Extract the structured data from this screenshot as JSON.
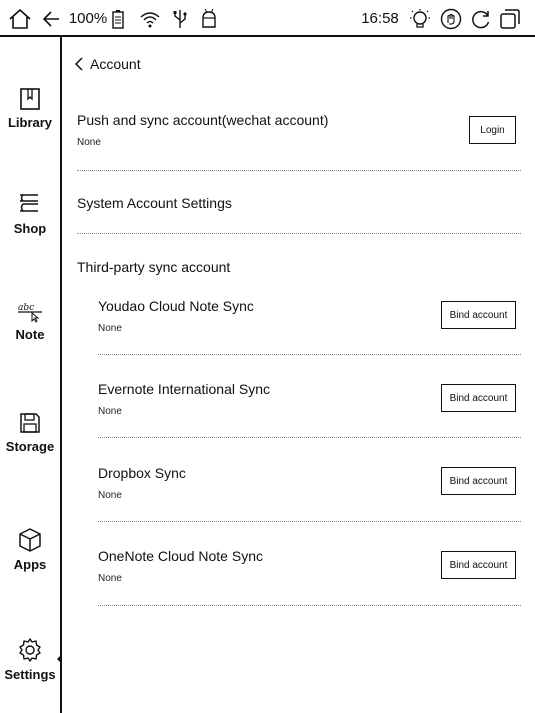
{
  "status_bar": {
    "icons": [
      "home-icon",
      "back-arrow-icon",
      "battery-icon",
      "wifi-icon",
      "usb-icon",
      "android-icon",
      "frontlight-icon",
      "touch-icon",
      "refresh-icon",
      "multitask-icon"
    ],
    "battery_percent": "100%",
    "time": "16:58"
  },
  "sidebar": {
    "items": [
      {
        "label": "Library",
        "icon": "library-icon"
      },
      {
        "label": "Shop",
        "icon": "shop-icon"
      },
      {
        "label": "Note",
        "icon": "note-icon"
      },
      {
        "label": "Storage",
        "icon": "storage-icon"
      },
      {
        "label": "Apps",
        "icon": "apps-icon"
      },
      {
        "label": "Settings",
        "icon": "settings-icon",
        "active": true
      }
    ]
  },
  "header": {
    "back_label": "Account"
  },
  "push_sync": {
    "title": "Push and sync account(wechat account)",
    "status": "None",
    "button": "Login"
  },
  "system_account": {
    "title": "System Account Settings"
  },
  "third_party": {
    "heading": "Third-party sync account",
    "services": [
      {
        "name": "Youdao Cloud Note Sync",
        "status": "None",
        "button": "Bind account"
      },
      {
        "name": "Evernote International Sync",
        "status": "None",
        "button": "Bind account"
      },
      {
        "name": "Dropbox Sync",
        "status": "None",
        "button": "Bind account"
      },
      {
        "name": "OneNote Cloud Note Sync",
        "status": "None",
        "button": "Bind account"
      }
    ]
  }
}
